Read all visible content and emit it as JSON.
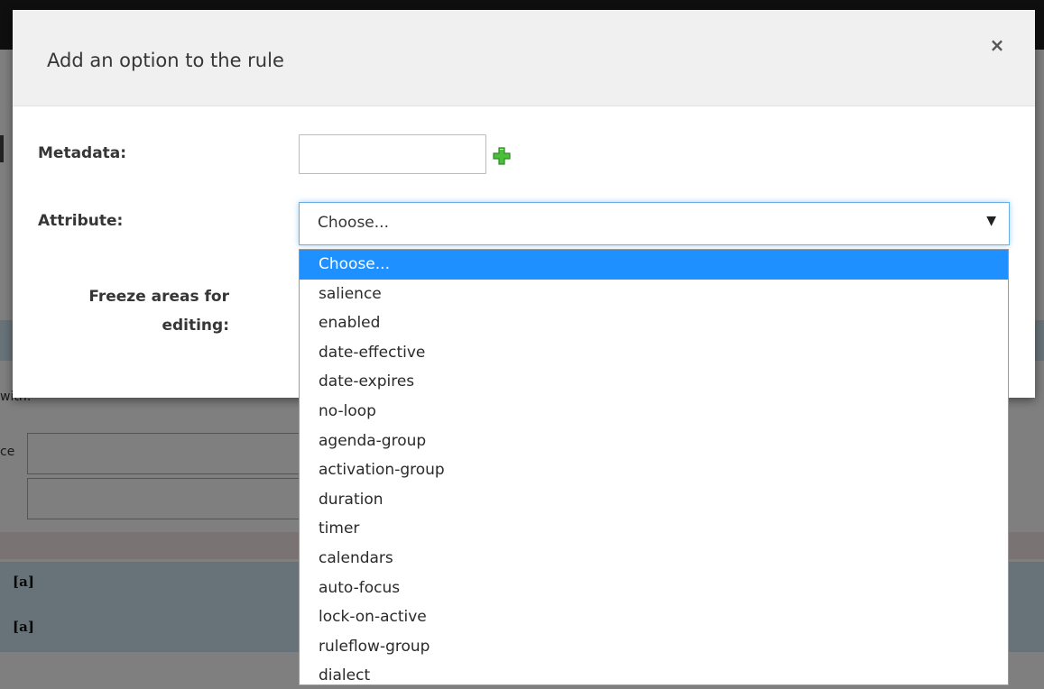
{
  "background": {
    "left_fragment": "with:",
    "label_fragment": "ce",
    "row_markers": [
      "[a]",
      "[a]"
    ]
  },
  "modal": {
    "title": "Add an option to the rule",
    "close_glyph": "×",
    "metadata_label": "Metadata:",
    "metadata_value": "",
    "attribute_label": "Attribute:",
    "attribute_selected": "Choose...",
    "freeze_label": "Freeze areas for editing:"
  },
  "dropdown": {
    "options": [
      "Choose...",
      "salience",
      "enabled",
      "date-effective",
      "date-expires",
      "no-loop",
      "agenda-group",
      "activation-group",
      "duration",
      "timer",
      "calendars",
      "auto-focus",
      "lock-on-active",
      "ruleflow-group",
      "dialect"
    ],
    "selected_index": 0
  },
  "colors": {
    "accent": "#1e90ff",
    "plus_icon": "#3cb23c",
    "focus_border": "#66afe9"
  }
}
